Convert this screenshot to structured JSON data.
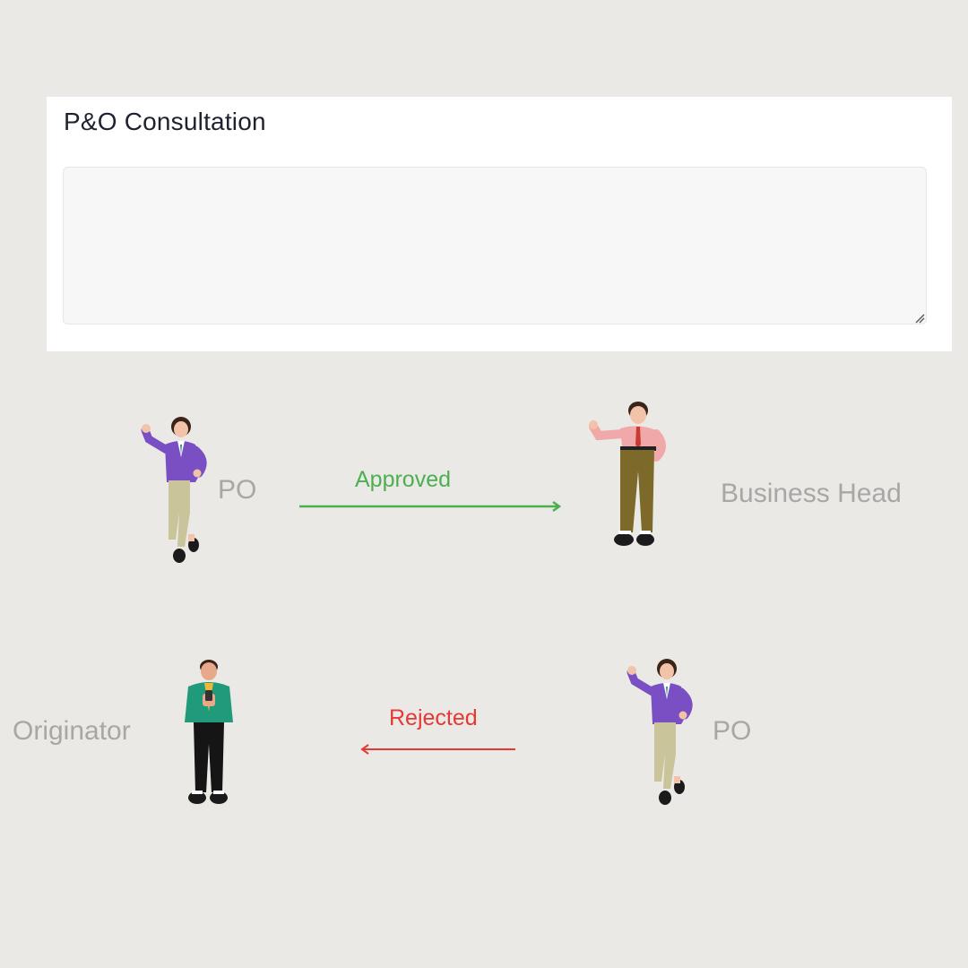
{
  "panel": {
    "title": "P&O Consultation",
    "textarea_value": ""
  },
  "flow": {
    "approved": {
      "from": "PO",
      "to": "Business Head",
      "label": "Approved",
      "color": "#4caf50"
    },
    "rejected": {
      "from": "PO",
      "to": "Originator",
      "label": "Rejected",
      "color": "#e53935"
    }
  },
  "colors": {
    "background": "#ebe9e5",
    "node_label": "#a8a7a5",
    "title": "#1e2230"
  },
  "icons": {
    "po_figure": "woman-purple-jacket-figure",
    "business_head_figure": "man-pink-shirt-figure",
    "originator_figure": "man-green-jacket-figure"
  }
}
